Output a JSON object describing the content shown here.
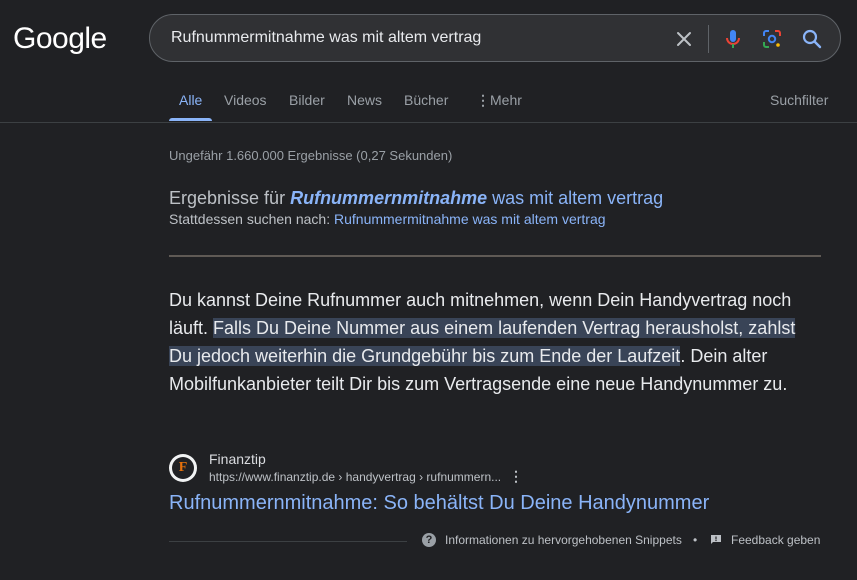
{
  "header": {
    "logo": "Google",
    "search_query": "Rufnummermitnahme was mit altem vertrag"
  },
  "tabs": [
    {
      "label": "Alle",
      "active": true
    },
    {
      "label": "Videos"
    },
    {
      "label": "Bilder"
    },
    {
      "label": "News"
    },
    {
      "label": "Bücher"
    },
    {
      "label": "Mehr"
    }
  ],
  "tools_label": "Suchfilter",
  "stats": "Ungefähr 1.660.000 Ergebnisse (0,27 Sekunden)",
  "spell": {
    "prefix": "Ergebnisse für",
    "corrected_term": "Rufnummernmitnahme",
    "rest": "was mit altem vertrag",
    "instead_prefix": "Stattdessen suchen nach:",
    "instead_query": "Rufnummermitnahme was mit altem vertrag"
  },
  "snippet": {
    "before": "Du kannst Deine Rufnummer auch mitnehmen, wenn Dein Handyvertrag noch läuft. ",
    "highlight": "Falls Du Deine Nummer aus einem laufenden Vertrag herausholst, zahlst Du jedoch weiterhin die Grundgebühr bis zum Ende der Laufzeit",
    "after": ". Dein alter Mobilfunkanbieter teilt Dir bis zum Vertragsende eine neue Handynummer zu."
  },
  "source": {
    "favicon_letter": "F",
    "name": "Finanztip",
    "url": "https://www.finanztip.de › handyvertrag › rufnummern...",
    "title": "Rufnummernmitnahme: So behältst Du Deine Handynummer"
  },
  "footer": {
    "info": "Informationen zu hervorgehobenen Snippets",
    "dot": "•",
    "feedback": "Feedback geben"
  },
  "colors": {
    "background": "#202124",
    "link": "#8ab4f8",
    "highlight": "#394457",
    "text": "#e8eaed"
  }
}
